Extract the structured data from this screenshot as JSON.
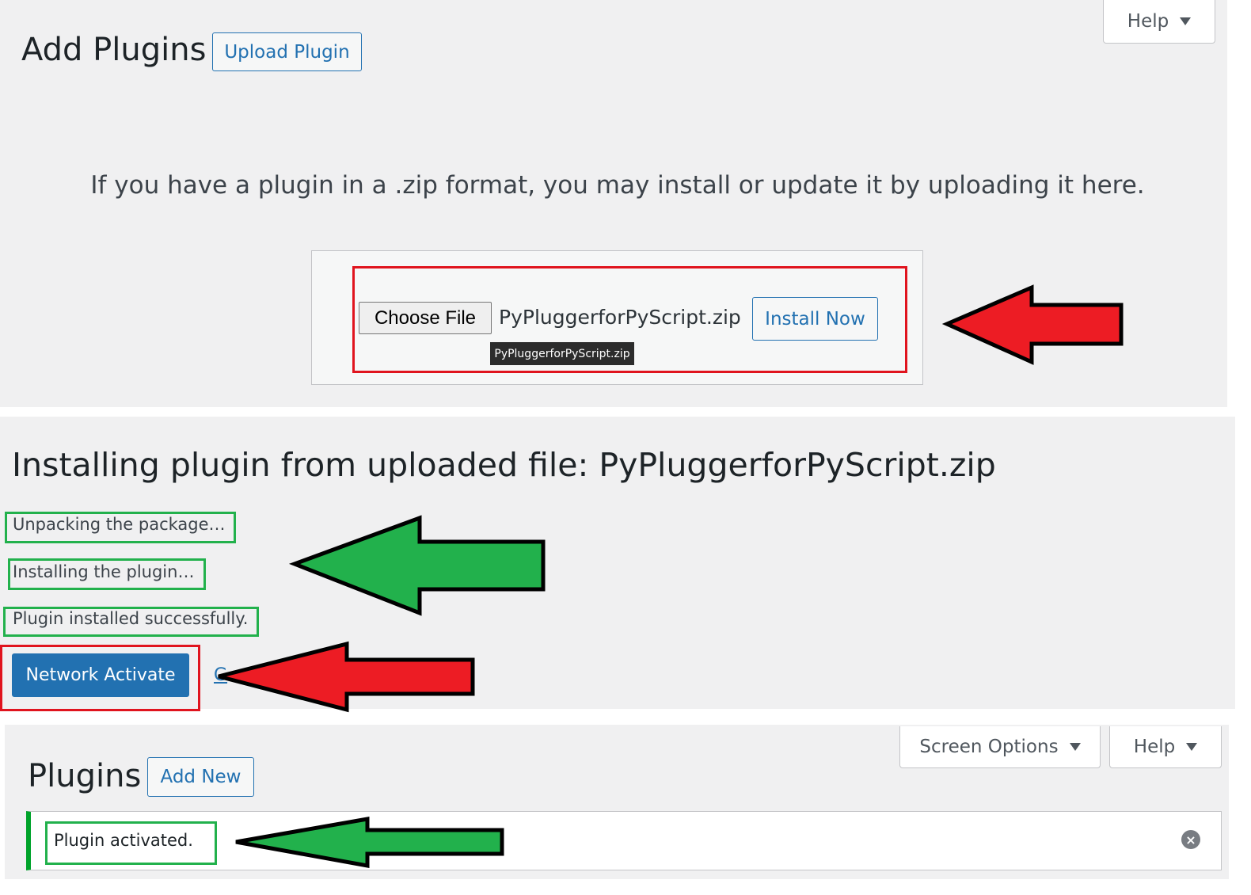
{
  "upload_page": {
    "title": "Add Plugins",
    "upload_button": "Upload Plugin",
    "help_tab": "Help",
    "description": "If you have a plugin in a .zip format, you may install or update it by uploading it here.",
    "choose_file_button": "Choose File",
    "selected_file": "PyPluggerforPyScript.zip",
    "tooltip": "PyPluggerforPyScript.zip",
    "install_button": "Install Now"
  },
  "install_page": {
    "title": "Installing plugin from uploaded file: PyPluggerforPyScript.zip",
    "steps": [
      "Unpacking the package…",
      "Installing the plugin…",
      "Plugin installed successfully."
    ],
    "activate_button": "Network Activate",
    "partial_link": "G"
  },
  "plugins_page": {
    "title": "Plugins",
    "add_new_button": "Add New",
    "screen_options_tab": "Screen Options",
    "help_tab": "Help",
    "notice": "Plugin activated.",
    "dismiss_icon": "×"
  },
  "colors": {
    "annotation_red": "#e0141e",
    "annotation_green": "#22b14c",
    "wp_blue": "#2271b1",
    "panel_bg": "#f0f0f1"
  },
  "icons": {
    "caret": "caret-down-icon",
    "dismiss": "dismiss-icon",
    "arrows": [
      "red-arrow-icon",
      "green-arrow-icon"
    ]
  }
}
